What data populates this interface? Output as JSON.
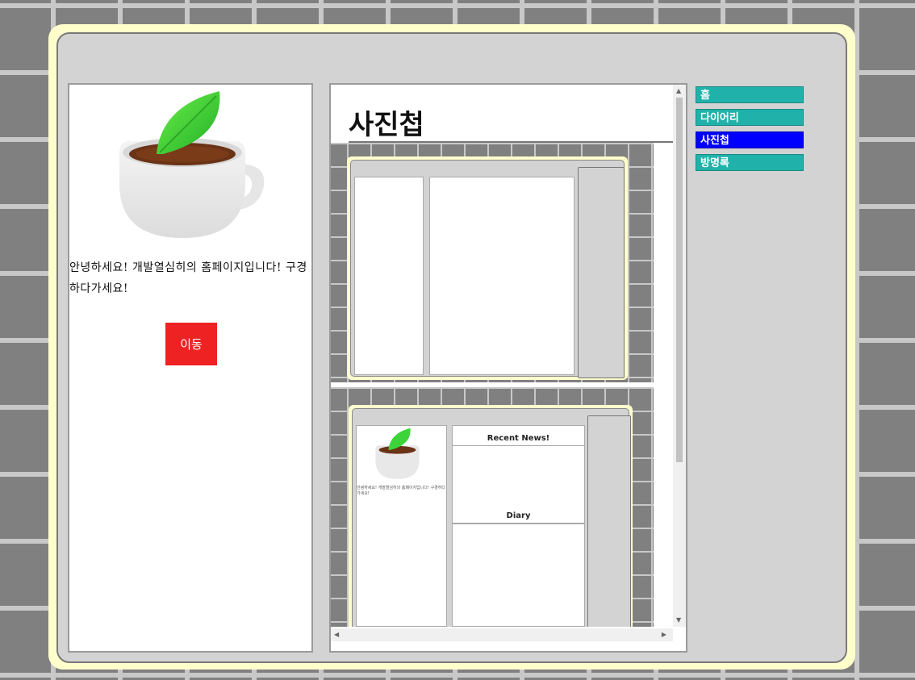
{
  "intro_text": "안녕하세요! 개발열심히의 홈페이지입니다! 구경하다가세요!",
  "go_button": "이동",
  "page_title": "사진첩",
  "nav": {
    "items": [
      {
        "label": "홈",
        "active": false
      },
      {
        "label": "다이어리",
        "active": false
      },
      {
        "label": "사진첩",
        "active": true
      },
      {
        "label": "방명록",
        "active": false
      }
    ]
  },
  "thumb2": {
    "recent_news": "Recent News!",
    "diary": "Diary",
    "mini_intro": "안녕하세요! 개발열심히의 홈페이지입니다! 구경하다가세요!"
  },
  "colors": {
    "nav_bg": "#20b2aa",
    "nav_active": "#0000ff",
    "button": "#ee2222",
    "frame": "#ffffcc"
  }
}
